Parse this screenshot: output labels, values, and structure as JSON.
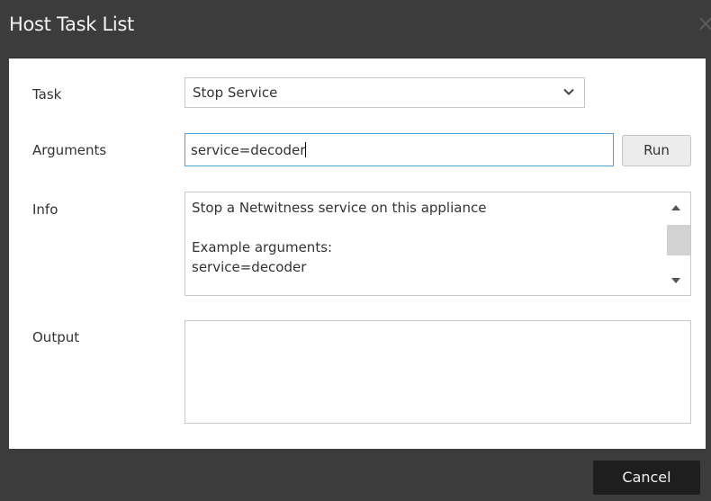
{
  "dialog": {
    "title": "Host Task List",
    "close_glyph": "×"
  },
  "form": {
    "task_label": "Task",
    "task_value": "Stop Service",
    "arguments_label": "Arguments",
    "arguments_value": "service=decoder",
    "run_label": "Run",
    "info_label": "Info",
    "info_lines": [
      "Stop a Netwitness service on this appliance",
      "",
      "Example arguments:",
      "service=decoder"
    ],
    "output_label": "Output",
    "output_value": ""
  },
  "footer": {
    "cancel_label": "Cancel"
  },
  "icons": {
    "select": "chevron-down-icon",
    "close": "close-icon",
    "scroll_up": "scroll-up-arrow-icon",
    "scroll_down": "scroll-down-arrow-icon"
  },
  "colors": {
    "titlebar": "#3c3c3c",
    "input_focus_border": "#4aa3df",
    "cancel_button": "#1e1e1e"
  }
}
